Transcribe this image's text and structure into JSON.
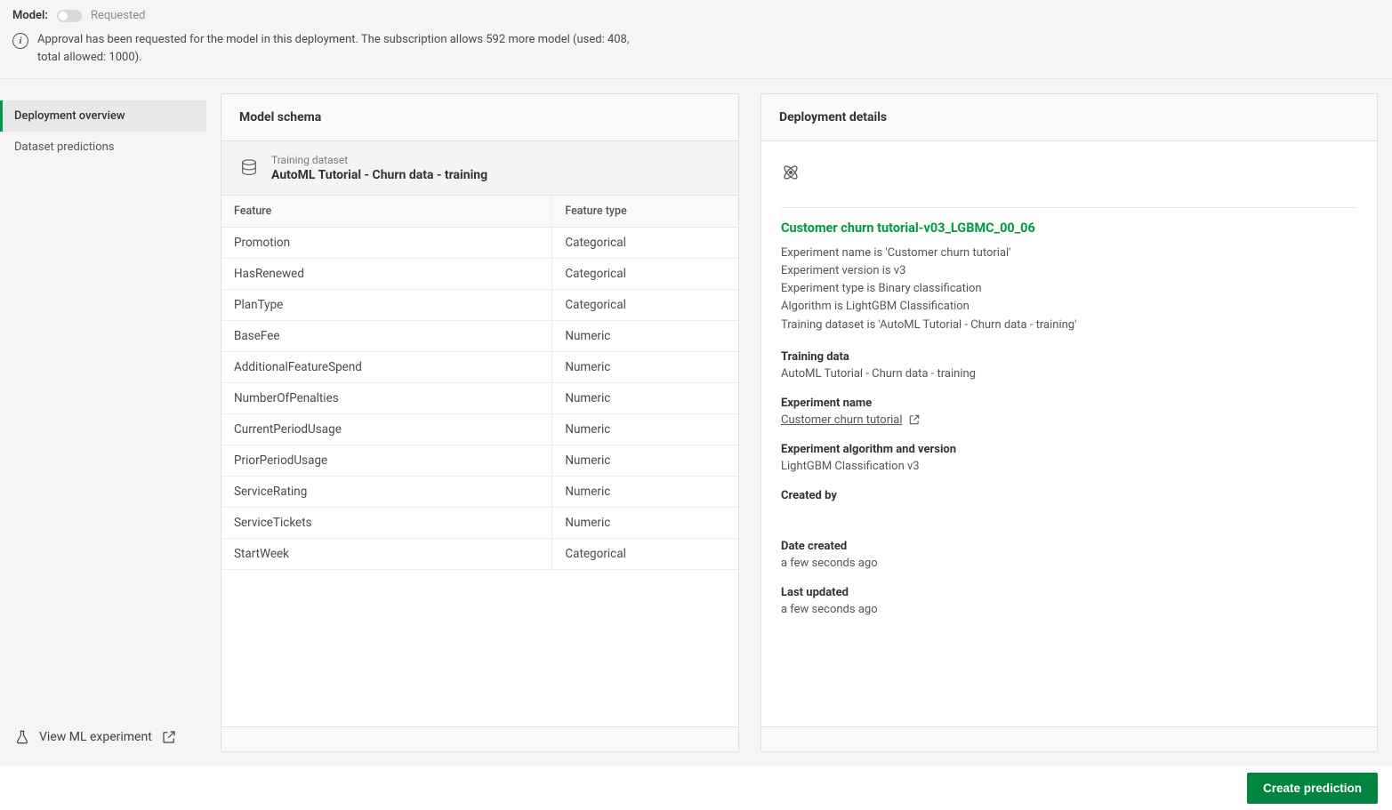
{
  "topbar": {
    "model_label": "Model:",
    "status": "Requested",
    "approval_msg": "Approval has been requested for the model in this deployment. The subscription allows 592 more model (used: 408, total allowed: 1000)."
  },
  "sidebar": {
    "items": [
      {
        "label": "Deployment overview",
        "active": true
      },
      {
        "label": "Dataset predictions",
        "active": false
      }
    ],
    "footer_label": "View ML experiment"
  },
  "schema": {
    "panel_title": "Model schema",
    "training_label": "Training dataset",
    "training_dataset": "AutoML Tutorial - Churn data - training",
    "columns": {
      "feature": "Feature",
      "type": "Feature type"
    },
    "rows": [
      {
        "feature": "Promotion",
        "type": "Categorical"
      },
      {
        "feature": "HasRenewed",
        "type": "Categorical"
      },
      {
        "feature": "PlanType",
        "type": "Categorical"
      },
      {
        "feature": "BaseFee",
        "type": "Numeric"
      },
      {
        "feature": "AdditionalFeatureSpend",
        "type": "Numeric"
      },
      {
        "feature": "NumberOfPenalties",
        "type": "Numeric"
      },
      {
        "feature": "CurrentPeriodUsage",
        "type": "Numeric"
      },
      {
        "feature": "PriorPeriodUsage",
        "type": "Numeric"
      },
      {
        "feature": "ServiceRating",
        "type": "Numeric"
      },
      {
        "feature": "ServiceTickets",
        "type": "Numeric"
      },
      {
        "feature": "StartWeek",
        "type": "Categorical"
      }
    ]
  },
  "details": {
    "panel_title": "Deployment details",
    "model_name": "Customer churn tutorial-v03_LGBMC_00_06",
    "meta": [
      "Experiment name is 'Customer churn tutorial'",
      "Experiment version is v3",
      "Experiment type is Binary classification",
      "Algorithm is LightGBM Classification",
      "Training dataset is 'AutoML Tutorial - Churn data - training'"
    ],
    "sections": {
      "training_data": {
        "label": "Training data",
        "value": "AutoML Tutorial - Churn data - training"
      },
      "experiment_name": {
        "label": "Experiment name",
        "value": "Customer churn tutorial"
      },
      "algorithm": {
        "label": "Experiment algorithm and version",
        "value": "LightGBM Classification v3"
      },
      "created_by": {
        "label": "Created by",
        "value": ""
      },
      "date_created": {
        "label": "Date created",
        "value": "a few seconds ago"
      },
      "last_updated": {
        "label": "Last updated",
        "value": "a few seconds ago"
      }
    }
  },
  "actions": {
    "create_prediction": "Create prediction"
  }
}
